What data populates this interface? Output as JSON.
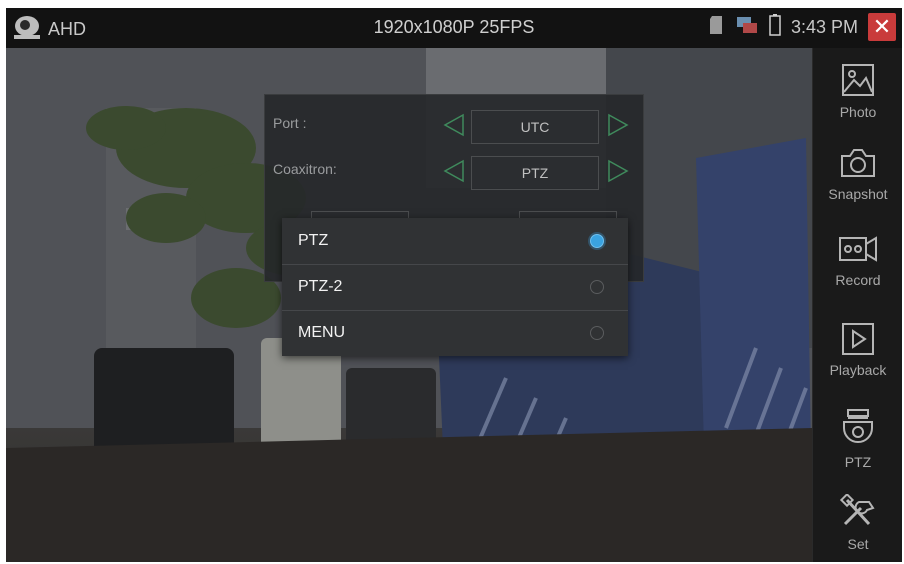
{
  "statusbar": {
    "mode": "AHD",
    "resolution": "1920x1080P 25FPS",
    "time": "3:43 PM"
  },
  "settings": {
    "port_label": "Port :",
    "port_value": "UTC",
    "coax_label": "Coaxitron:",
    "coax_value": "PTZ"
  },
  "dropdown": {
    "options": [
      {
        "label": "PTZ",
        "selected": true
      },
      {
        "label": "PTZ-2",
        "selected": false
      },
      {
        "label": "MENU",
        "selected": false
      }
    ]
  },
  "sidebar": {
    "items": [
      {
        "label": "Photo",
        "icon": "photo-icon"
      },
      {
        "label": "Snapshot",
        "icon": "camera-icon"
      },
      {
        "label": "Record",
        "icon": "video-record-icon"
      },
      {
        "label": "Playback",
        "icon": "play-icon"
      },
      {
        "label": "PTZ",
        "icon": "ptz-camera-icon"
      },
      {
        "label": "Set",
        "icon": "tools-icon"
      }
    ]
  },
  "colors": {
    "accent": "#3aa3e0",
    "close": "#c93b3b"
  }
}
